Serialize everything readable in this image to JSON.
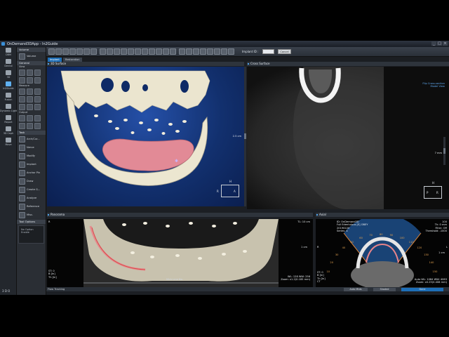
{
  "window": {
    "title": "OnDemand3DApp - In2Guide",
    "buttons": [
      "_",
      "□",
      "×"
    ]
  },
  "rail": {
    "items": [
      {
        "label": "DBM",
        "icon": "database-icon"
      },
      {
        "label": "Dental",
        "icon": "tooth-icon"
      },
      {
        "label": "3D",
        "icon": "cube-icon"
      },
      {
        "label": "In2Guide",
        "icon": "guide-icon",
        "active": true
      },
      {
        "label": "Fusion",
        "icon": "fusion-icon"
      },
      {
        "label": "Dynamic LightBox",
        "icon": "lightbox-icon"
      },
      {
        "label": "Report",
        "icon": "report-icon"
      },
      {
        "label": "3D Ceph",
        "icon": "ceph-icon"
      },
      {
        "label": "Move",
        "icon": "move-icon"
      }
    ],
    "logo": "3 D O"
  },
  "tools": {
    "volume_header": "Volume",
    "volume_item": "Volume",
    "general_header": "General",
    "view_header": "View",
    "measure_header": "Measure",
    "output_header": "Output",
    "task_header": "Task",
    "tasks": [
      "Arch/Cur...",
      "Nerve",
      "Modify",
      "Implant",
      "Anchor Pin",
      "Draw",
      "Create G...",
      "Analyze",
      "Reference",
      "Misc."
    ],
    "options_header": "Tool Options",
    "options_text": "No Option Enable"
  },
  "toolbar": {
    "implant_label": "Implant ID :",
    "implant_value": "",
    "cancel_label": "Cancel"
  },
  "tabs": [
    "Implant",
    "Restoration"
  ],
  "views": {
    "surface": {
      "title": "3D Surface",
      "scale": "2.5 cm",
      "orient_top": "H",
      "orient_left": "R",
      "orient_right": "A"
    },
    "cross": {
      "title": "Cross Surface",
      "mode_line1": "Flip Cross-section",
      "mode_line2": "Model View",
      "scale": "7 mm",
      "orient_top": "H",
      "orient_left": "P",
      "orient_right": "R"
    },
    "pano": {
      "title": "Panorama",
      "info": "ID: OnDemand3D\nFull Edentulous [E] OBEY\n20190220\nSeries: 4",
      "wl": "WL: 128 WW: 256\nZoom: x1.2(0.185 mm)",
      "pos": "ST: 0\nB [in]\nTh [in]",
      "tr": "TL: 10 cm",
      "bottom": "Mick Line No.",
      "scale": "1 cm",
      "orient": "R"
    },
    "axial": {
      "title": "Axial",
      "info": "ID: OnDemand3D\nFull Edentulous [E] OBEY\n20190220\nSeries: 4",
      "tr": "100\nTh: 0 mm\nFilter: Off\nThreshold: -1000",
      "wl": "Auto WL: 1084 WW: 4063\nZoom: x0.25(0.408 mm)",
      "pos": "ST: 0\nB [in]\nTh [in]\nCT",
      "scale": "1 cm",
      "orient_left": "R",
      "orient_right": "L",
      "arc_labels": [
        "10",
        "20",
        "30",
        "40",
        "50",
        "60",
        "70",
        "80",
        "90",
        "100",
        "110",
        "120",
        "130",
        "140",
        "150"
      ]
    }
  },
  "status": {
    "left": "Flow Tracking",
    "auto_label": "Auto Mtds",
    "shaded_label": "Shaded",
    "done_label": "Done"
  },
  "colors": {
    "accent": "#1e6fb8",
    "surface_bg": "#12306e",
    "bone": "#e8e2cc",
    "gum": "#e28a96",
    "nerve": "#d94a4a"
  }
}
